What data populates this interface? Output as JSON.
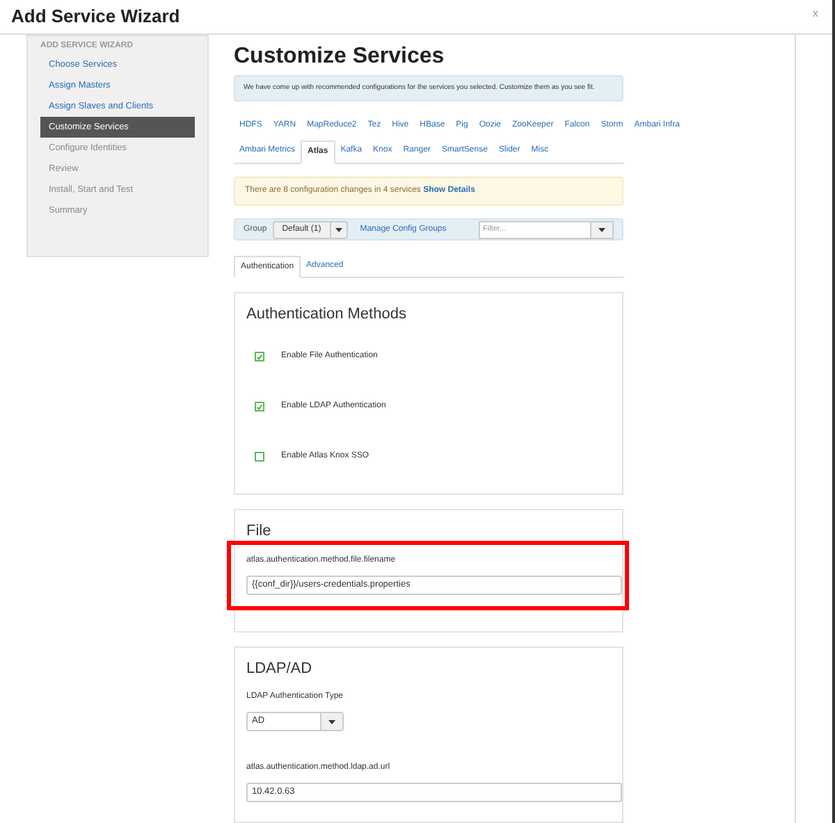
{
  "window": {
    "title": "Add Service Wizard",
    "close": "x"
  },
  "sidebar": {
    "header": "ADD SERVICE WIZARD",
    "items": [
      {
        "label": "Choose Services",
        "selected": false,
        "disabled": false
      },
      {
        "label": "Assign Masters",
        "selected": false,
        "disabled": false
      },
      {
        "label": "Assign Slaves and Clients",
        "selected": false,
        "disabled": false
      },
      {
        "label": "Customize Services",
        "selected": true,
        "disabled": false
      },
      {
        "label": "Configure Identities",
        "selected": false,
        "disabled": true
      },
      {
        "label": "Review",
        "selected": false,
        "disabled": true
      },
      {
        "label": "Install, Start and Test",
        "selected": false,
        "disabled": true
      },
      {
        "label": "Summary",
        "selected": false,
        "disabled": true
      }
    ]
  },
  "page": {
    "title": "Customize Services",
    "info": "We have come up with recommended configurations for the services you selected. Customize them as you see fit."
  },
  "service_tabs": [
    [
      {
        "label": "HDFS",
        "selected": false
      },
      {
        "label": "YARN",
        "selected": false
      },
      {
        "label": "MapReduce2",
        "selected": false
      },
      {
        "label": "Tez",
        "selected": false
      },
      {
        "label": "Hive",
        "selected": false
      },
      {
        "label": "HBase",
        "selected": false
      },
      {
        "label": "Pig",
        "selected": false
      },
      {
        "label": "Oozie",
        "selected": false
      },
      {
        "label": "ZooKeeper",
        "selected": false
      },
      {
        "label": "Falcon",
        "selected": false
      },
      {
        "label": "Storm",
        "selected": false
      },
      {
        "label": "Ambari Infra",
        "selected": false
      }
    ],
    [
      {
        "label": "Ambari Metrics",
        "selected": false
      },
      {
        "label": "Atlas",
        "selected": true
      },
      {
        "label": "Kafka",
        "selected": false
      },
      {
        "label": "Knox",
        "selected": false
      },
      {
        "label": "Ranger",
        "selected": false
      },
      {
        "label": "SmartSense",
        "selected": false
      },
      {
        "label": "Slider",
        "selected": false
      },
      {
        "label": "Misc",
        "selected": false
      }
    ]
  ],
  "notice": {
    "text": "There are 8 configuration changes in 4 services",
    "link": "Show Details"
  },
  "group_bar": {
    "label": "Group",
    "group": "Default (1)",
    "manage": "Manage Config Groups",
    "filter_placeholder": "Filter..."
  },
  "config_tabs": [
    {
      "label": "Authentication",
      "selected": true
    },
    {
      "label": "Advanced",
      "selected": false
    }
  ],
  "sections": [
    {
      "title": "Authentication Methods",
      "fields": [
        {
          "kind": "checkbox",
          "label": "Enable File Authentication",
          "checked": true
        },
        {
          "kind": "checkbox",
          "label": "Enable LDAP Authentication",
          "checked": true
        },
        {
          "kind": "checkbox",
          "label": "Enable Atlas Knox SSO",
          "checked": false
        }
      ]
    },
    {
      "title": "File",
      "highlighted": true,
      "fields": [
        {
          "kind": "text",
          "label": "atlas.authentication.method.file.filename",
          "value": "{{conf_dir}}/users-credentials.properties"
        }
      ]
    },
    {
      "title": "LDAP/AD",
      "fields": [
        {
          "kind": "select",
          "label": "LDAP Authentication Type",
          "value": "AD"
        },
        {
          "kind": "text",
          "label": "atlas.authentication.method.ldap.ad.url",
          "value": "10.42.0.63"
        }
      ]
    }
  ]
}
